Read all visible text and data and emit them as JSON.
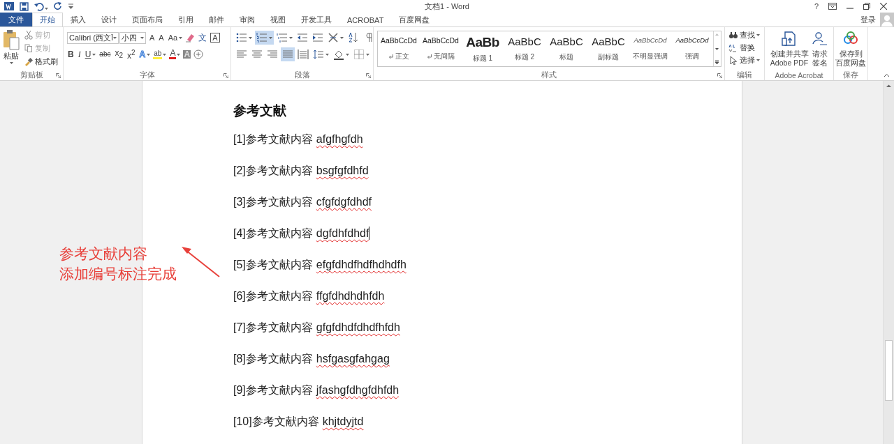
{
  "title_bar": {
    "title": "文档1 - Word",
    "help": "?"
  },
  "file_tab": "文件",
  "tabs": [
    {
      "label": "开始",
      "selected": true
    },
    {
      "label": "插入",
      "selected": false
    },
    {
      "label": "设计",
      "selected": false
    },
    {
      "label": "页面布局",
      "selected": false
    },
    {
      "label": "引用",
      "selected": false
    },
    {
      "label": "邮件",
      "selected": false
    },
    {
      "label": "审阅",
      "selected": false
    },
    {
      "label": "视图",
      "selected": false
    },
    {
      "label": "开发工具",
      "selected": false
    },
    {
      "label": "ACROBAT",
      "selected": false
    },
    {
      "label": "百度网盘",
      "selected": false
    }
  ],
  "login": "登录",
  "clipboard": {
    "label": "剪贴板",
    "paste": "粘贴",
    "items": [
      {
        "kind": "cut",
        "label": "剪切",
        "disabled": true
      },
      {
        "kind": "copy",
        "label": "复制",
        "disabled": true
      },
      {
        "kind": "painter",
        "label": "格式刷",
        "disabled": false
      }
    ]
  },
  "font": {
    "label": "字体",
    "font_name": "Calibri (西文Ī",
    "font_size": "小四",
    "row1": [
      {
        "kind": "grow",
        "text": "A",
        "dropdown": false
      },
      {
        "kind": "shrink",
        "text": "A",
        "dropdown": false
      },
      {
        "kind": "case",
        "text": "Aa",
        "dropdown": true
      },
      {
        "kind": "clear",
        "dropdown": false
      },
      {
        "kind": "phonetic",
        "text": "文",
        "dropdown": false
      },
      {
        "kind": "border",
        "text": "A",
        "dropdown": false
      }
    ],
    "row2": [
      {
        "kind": "bold",
        "text": "B",
        "dropdown": false
      },
      {
        "kind": "italic",
        "text": "I",
        "dropdown": false
      },
      {
        "kind": "underline",
        "text": "U",
        "dropdown": true
      },
      {
        "kind": "strike",
        "text": "abc",
        "dropdown": false
      },
      {
        "kind": "sub",
        "text": "x$_{2}$",
        "dropdown": false
      },
      {
        "kind": "sup",
        "text": "x$^{2}$",
        "dropdown": false
      },
      {
        "kind": "effect",
        "text": "A",
        "dropdown": true
      },
      {
        "kind": "highlight",
        "text": "ab",
        "dropdown": true
      },
      {
        "kind": "color",
        "text": "A",
        "dropdown": true
      },
      {
        "kind": "shade",
        "text": "A",
        "dropdown": false
      },
      {
        "kind": "enclose",
        "dropdown": false
      }
    ]
  },
  "paragraph": {
    "label": "段落",
    "row1": [
      {
        "kind": "bullets",
        "dropdown": true,
        "selected": false
      },
      {
        "kind": "numbering",
        "dropdown": true,
        "selected": true
      },
      {
        "kind": "multilevel",
        "dropdown": true,
        "selected": false
      },
      {
        "kind": "outdent",
        "dropdown": false,
        "selected": false
      },
      {
        "kind": "indent",
        "dropdown": false,
        "selected": false
      },
      {
        "kind": "layout",
        "dropdown": true,
        "selected": false
      },
      {
        "kind": "sort",
        "dropdown": false,
        "selected": false
      },
      {
        "kind": "marks",
        "dropdown": false,
        "selected": false
      }
    ],
    "row2": [
      {
        "kind": "left",
        "dropdown": false,
        "selected": false
      },
      {
        "kind": "center",
        "dropdown": false,
        "selected": false
      },
      {
        "kind": "right",
        "dropdown": false,
        "selected": false
      },
      {
        "kind": "justify",
        "dropdown": false,
        "selected": true
      },
      {
        "kind": "distribute",
        "dropdown": false,
        "selected": false
      },
      {
        "kind": "spacing",
        "dropdown": true,
        "selected": false
      },
      {
        "kind": "fill",
        "dropdown": true,
        "selected": false
      },
      {
        "kind": "borders",
        "dropdown": true,
        "selected": false
      }
    ]
  },
  "styles": {
    "label": "样式",
    "items": [
      {
        "kind": "body",
        "preview": "AaBbCcDd",
        "name": "正文",
        "mark": true
      },
      {
        "kind": "body",
        "preview": "AaBbCcDd",
        "name": "无间隔",
        "mark": true
      },
      {
        "kind": "heading1",
        "preview": "AaBb",
        "name": "标题 1",
        "mark": false
      },
      {
        "kind": "heading2",
        "preview": "AaBbC",
        "name": "标题 2",
        "mark": false
      },
      {
        "kind": "title",
        "preview": "AaBbC",
        "name": "标题",
        "mark": false
      },
      {
        "kind": "subtitle",
        "preview": "AaBbC",
        "name": "副标题",
        "mark": false
      },
      {
        "kind": "subtle",
        "preview": "AaBbCcDd",
        "name": "不明显强调",
        "mark": false
      },
      {
        "kind": "emphasis",
        "preview": "AaBbCcDd",
        "name": "强调",
        "mark": false
      }
    ]
  },
  "editing": {
    "label": "编辑",
    "items": [
      {
        "kind": "find",
        "label": "查找",
        "dropdown": true
      },
      {
        "kind": "replace",
        "label": "替换",
        "dropdown": false
      },
      {
        "kind": "select",
        "label": "选择",
        "dropdown": true
      }
    ]
  },
  "acrobat": {
    "label": "Adobe Acrobat",
    "items": [
      {
        "kind": "pdf",
        "lines": [
          "创建并共享",
          "Adobe PDF"
        ]
      },
      {
        "kind": "sign",
        "lines": [
          "请求",
          "签名"
        ]
      }
    ]
  },
  "save": {
    "label": "保存",
    "items": [
      {
        "kind": "cloud",
        "lines": [
          "保存到",
          "百度网盘"
        ]
      }
    ]
  },
  "document": {
    "heading": "参考文献",
    "references": [
      {
        "number": "[1]",
        "text": "参考文献内容",
        "code": "afgfhgfdh",
        "cursor": false
      },
      {
        "number": "[2]",
        "text": "参考文献内容",
        "code": "bsgfgfdhfd",
        "cursor": false
      },
      {
        "number": "[3]",
        "text": "参考文献内容",
        "code": "cfgfdgfdhdf",
        "cursor": false
      },
      {
        "number": "[4]",
        "text": "参考文献内容",
        "code": "dgfdhfdhdf",
        "cursor": true
      },
      {
        "number": "[5]",
        "text": "参考文献内容",
        "code": "efgfdhdfhdfhdhdfh",
        "cursor": false
      },
      {
        "number": "[6]",
        "text": "参考文献内容",
        "code": "ffgfdhdhdhfdh",
        "cursor": false
      },
      {
        "number": "[7]",
        "text": "参考文献内容",
        "code": "gfgfdhdfdhdfhfdh",
        "cursor": false
      },
      {
        "number": "[8]",
        "text": "参考文献内容",
        "code": "hsfgasgfahgag",
        "cursor": false
      },
      {
        "number": "[9]",
        "text": "参考文献内容",
        "code": "jfashgfdhgfdhfdh",
        "cursor": false
      },
      {
        "number": "[10]",
        "text": "参考文献内容",
        "code": "khjtdyjtd",
        "cursor": false
      }
    ]
  },
  "annotation": {
    "lines": [
      "参考文献内容",
      "添加编号标注完成"
    ]
  }
}
